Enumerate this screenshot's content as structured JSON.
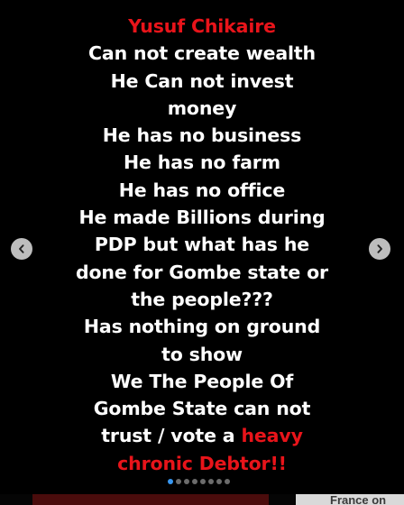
{
  "post": {
    "lines": [
      {
        "text": "Yusuf Chikaire",
        "color": "red"
      },
      {
        "text": "Can not create wealth",
        "color": "white"
      },
      {
        "text": "He Can not invest",
        "color": "white"
      },
      {
        "text": "money",
        "color": "white"
      },
      {
        "text": "He has no business",
        "color": "white"
      },
      {
        "text": "He has no farm",
        "color": "white"
      },
      {
        "text": "He has no office",
        "color": "white"
      },
      {
        "text": "He made Billions during",
        "color": "white"
      },
      {
        "text": "PDP but what has he",
        "color": "white"
      },
      {
        "text": "done for Gombe state or",
        "color": "white"
      },
      {
        "text": "the people???",
        "color": "white"
      },
      {
        "text": "Has nothing on ground",
        "color": "white"
      },
      {
        "text": "to show",
        "color": "white"
      },
      {
        "text": "We The People Of",
        "color": "white"
      },
      {
        "text": "Gombe State can not",
        "color": "white"
      },
      {
        "text_white": "trust / vote a ",
        "text_red": "heavy"
      },
      {
        "text": "chronic Debtor!!",
        "color": "red"
      }
    ],
    "accent_red": "#e8141a",
    "text_color": "#ffffff",
    "background": "#000000"
  },
  "carousel": {
    "prev_icon": "chevron-left-icon",
    "next_icon": "chevron-right-icon",
    "slide_count": 8,
    "active_index": 0,
    "active_dot_color": "#3897f0"
  },
  "footer": {
    "right_text": "France on"
  }
}
